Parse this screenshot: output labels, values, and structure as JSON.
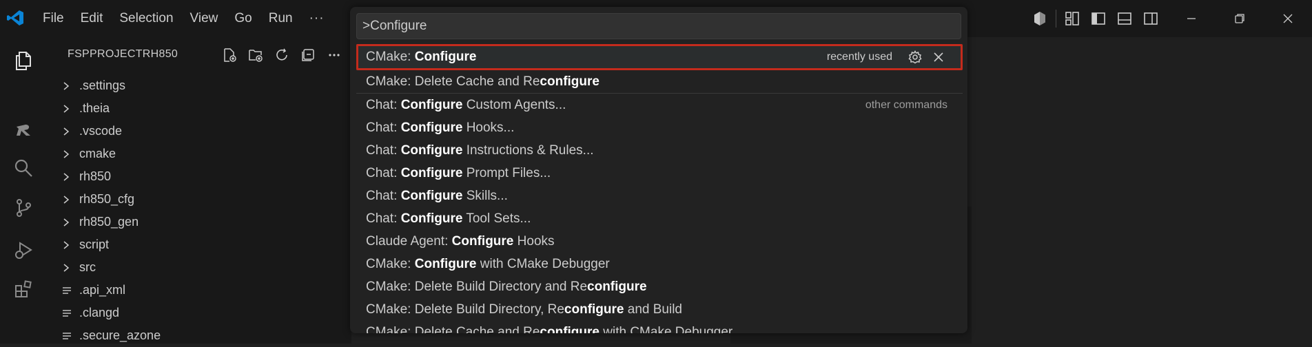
{
  "titlebar": {
    "menu": [
      "File",
      "Edit",
      "Selection",
      "View",
      "Go",
      "Run"
    ],
    "more": "···"
  },
  "sidebar": {
    "title": "FSPPROJECTRH850",
    "folders": [
      ".settings",
      ".theia",
      ".vscode",
      "cmake",
      "rh850",
      "rh850_cfg",
      "rh850_gen",
      "script",
      "src"
    ],
    "files": [
      ".api_xml",
      ".clangd",
      ".secure_azone"
    ]
  },
  "quick_input": {
    "value": ">Configure",
    "selected": {
      "prefix": "CMake: ",
      "match": "Configure",
      "suffix": "",
      "tag": "recently used"
    },
    "items": [
      {
        "pre": "CMake: Delete Cache and Re",
        "match": "configure",
        "post": ""
      },
      {
        "pre": "Chat: ",
        "match": "Configure",
        "post": " Custom Agents...",
        "category": "other commands"
      },
      {
        "pre": "Chat: ",
        "match": "Configure",
        "post": " Hooks..."
      },
      {
        "pre": "Chat: ",
        "match": "Configure",
        "post": " Instructions & Rules..."
      },
      {
        "pre": "Chat: ",
        "match": "Configure",
        "post": " Prompt Files..."
      },
      {
        "pre": "Chat: ",
        "match": "Configure",
        "post": " Skills..."
      },
      {
        "pre": "Chat: ",
        "match": "Configure",
        "post": " Tool Sets..."
      },
      {
        "pre": "Claude Agent: ",
        "match": "Configure",
        "post": " Hooks"
      },
      {
        "pre": "CMake: ",
        "match": "Configure",
        "post": " with CMake Debugger"
      },
      {
        "pre": "CMake: Delete Build Directory and Re",
        "match": "configure",
        "post": ""
      },
      {
        "pre": "CMake: Delete Build Directory, Re",
        "match": "configure",
        "post": " and Build"
      },
      {
        "pre": "CMake: Delete Cache and Re",
        "match": "configure",
        "post": " with CMake Debugger"
      }
    ]
  },
  "colors": {
    "accent": "#0078d4",
    "selection_outline": "#c42b1c"
  }
}
